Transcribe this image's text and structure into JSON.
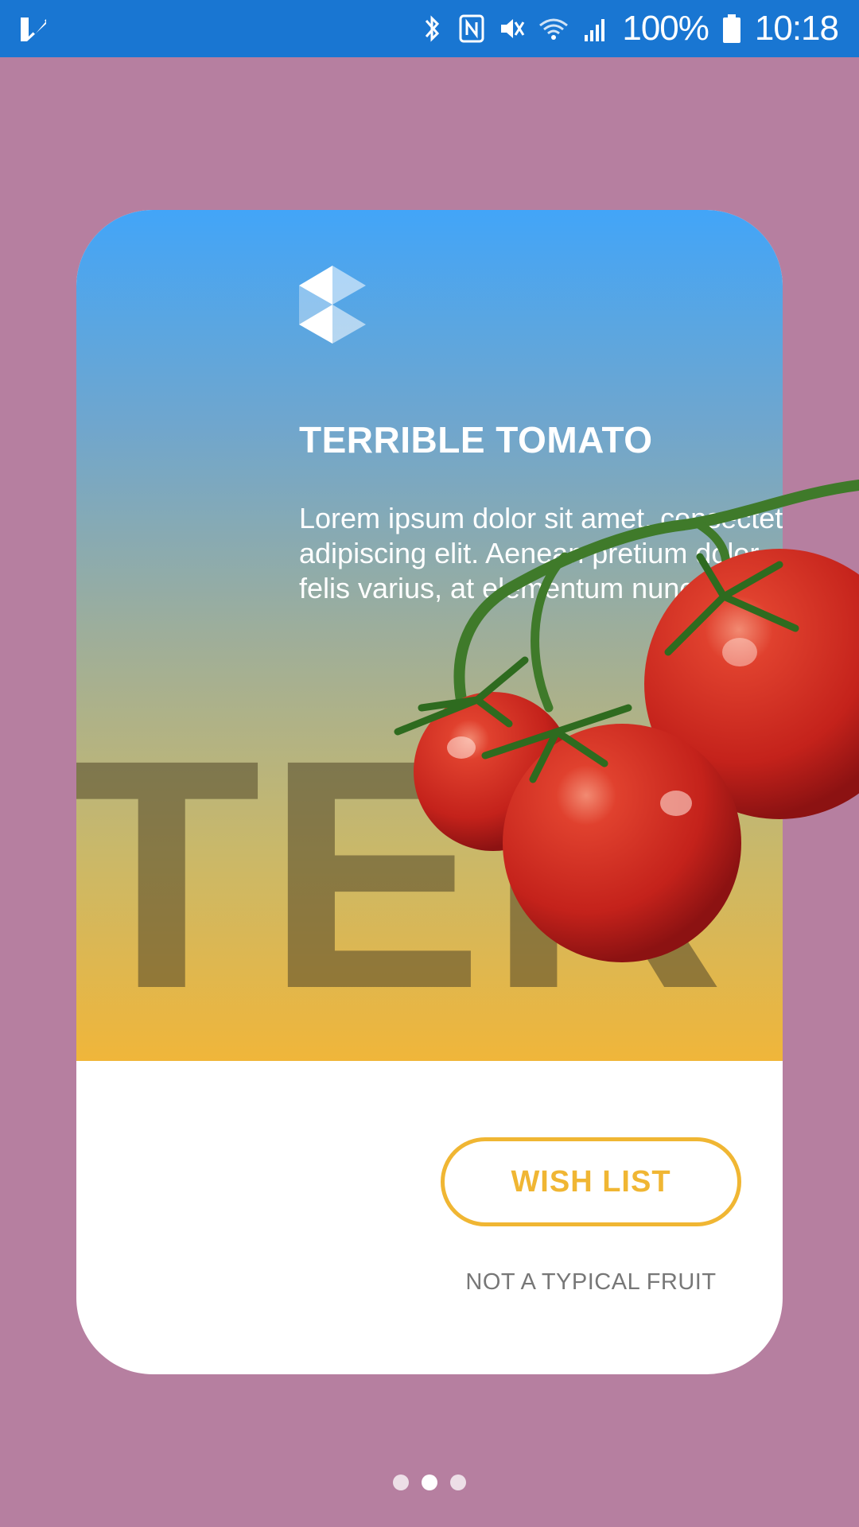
{
  "status_bar": {
    "battery_text": "100%",
    "time": "10:18",
    "icons": [
      "app-check-icon",
      "bluetooth-icon",
      "nfc-icon",
      "mute-icon",
      "wifi-icon",
      "signal-icon",
      "battery-icon"
    ],
    "background_color": "#1976d2"
  },
  "card": {
    "title": "TERRIBLE TOMATO",
    "description_lines": [
      "Lorem ipsum dolor sit amet, consectetur",
      "adipiscing elit. Aenean pretium dolor",
      "felis varius, at elementum nunc"
    ],
    "background_text": "TER",
    "gradient_colors": [
      "#42a5f8",
      "#f0b63a"
    ],
    "wish_button_label": "WISH LIST",
    "tagline": "NOT A TYPICAL FRUIT",
    "accent_color": "#f0b633"
  },
  "pager": {
    "pages": 3,
    "active_index": 1
  },
  "page_background": "#b67fa0"
}
